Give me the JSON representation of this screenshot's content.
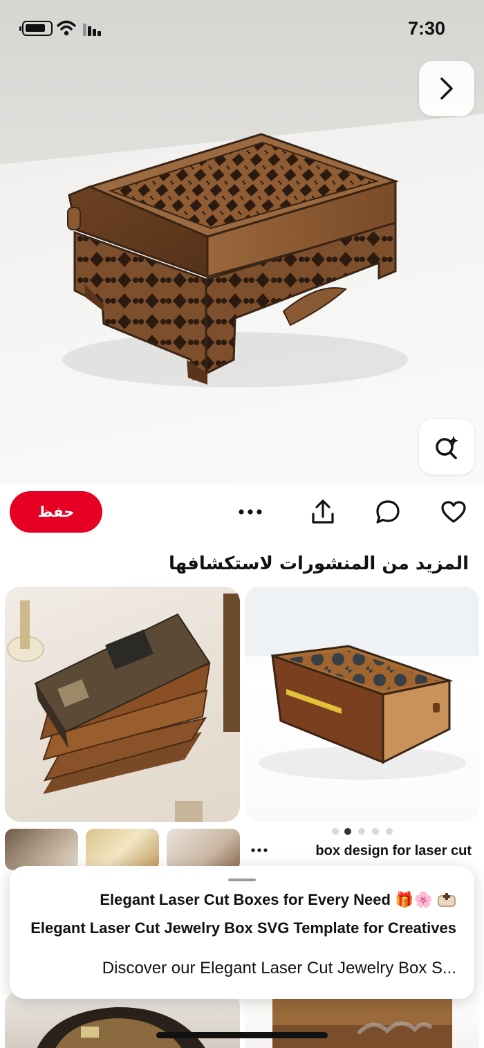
{
  "status_bar": {
    "time": "7:30"
  },
  "hero": {
    "alt": "laser cut wooden box"
  },
  "actions": {
    "save_label": "حفظ"
  },
  "more_section": {
    "title": "المزيد من المنشورات لاستكشافها"
  },
  "pins": [
    {
      "title": "box design for laser cut",
      "carousel_pages": 5,
      "carousel_active": 2
    }
  ],
  "sheet": {
    "line1": "Elegant Laser Cut Boxes for Every Need",
    "line1_emojis": "🎁🌸",
    "line2": "Elegant Laser Cut Jewelry Box SVG Template for Creatives",
    "line3": "Discover our Elegant Laser Cut Jewelry Box S..."
  },
  "icons": {
    "next": "chevron-right-icon",
    "lens": "visual-search-icon",
    "more": "more-dots-icon",
    "share": "share-icon",
    "comment": "comment-icon",
    "like": "heart-icon"
  },
  "colors": {
    "save": "#e60023",
    "wood": "#8a5a34"
  }
}
